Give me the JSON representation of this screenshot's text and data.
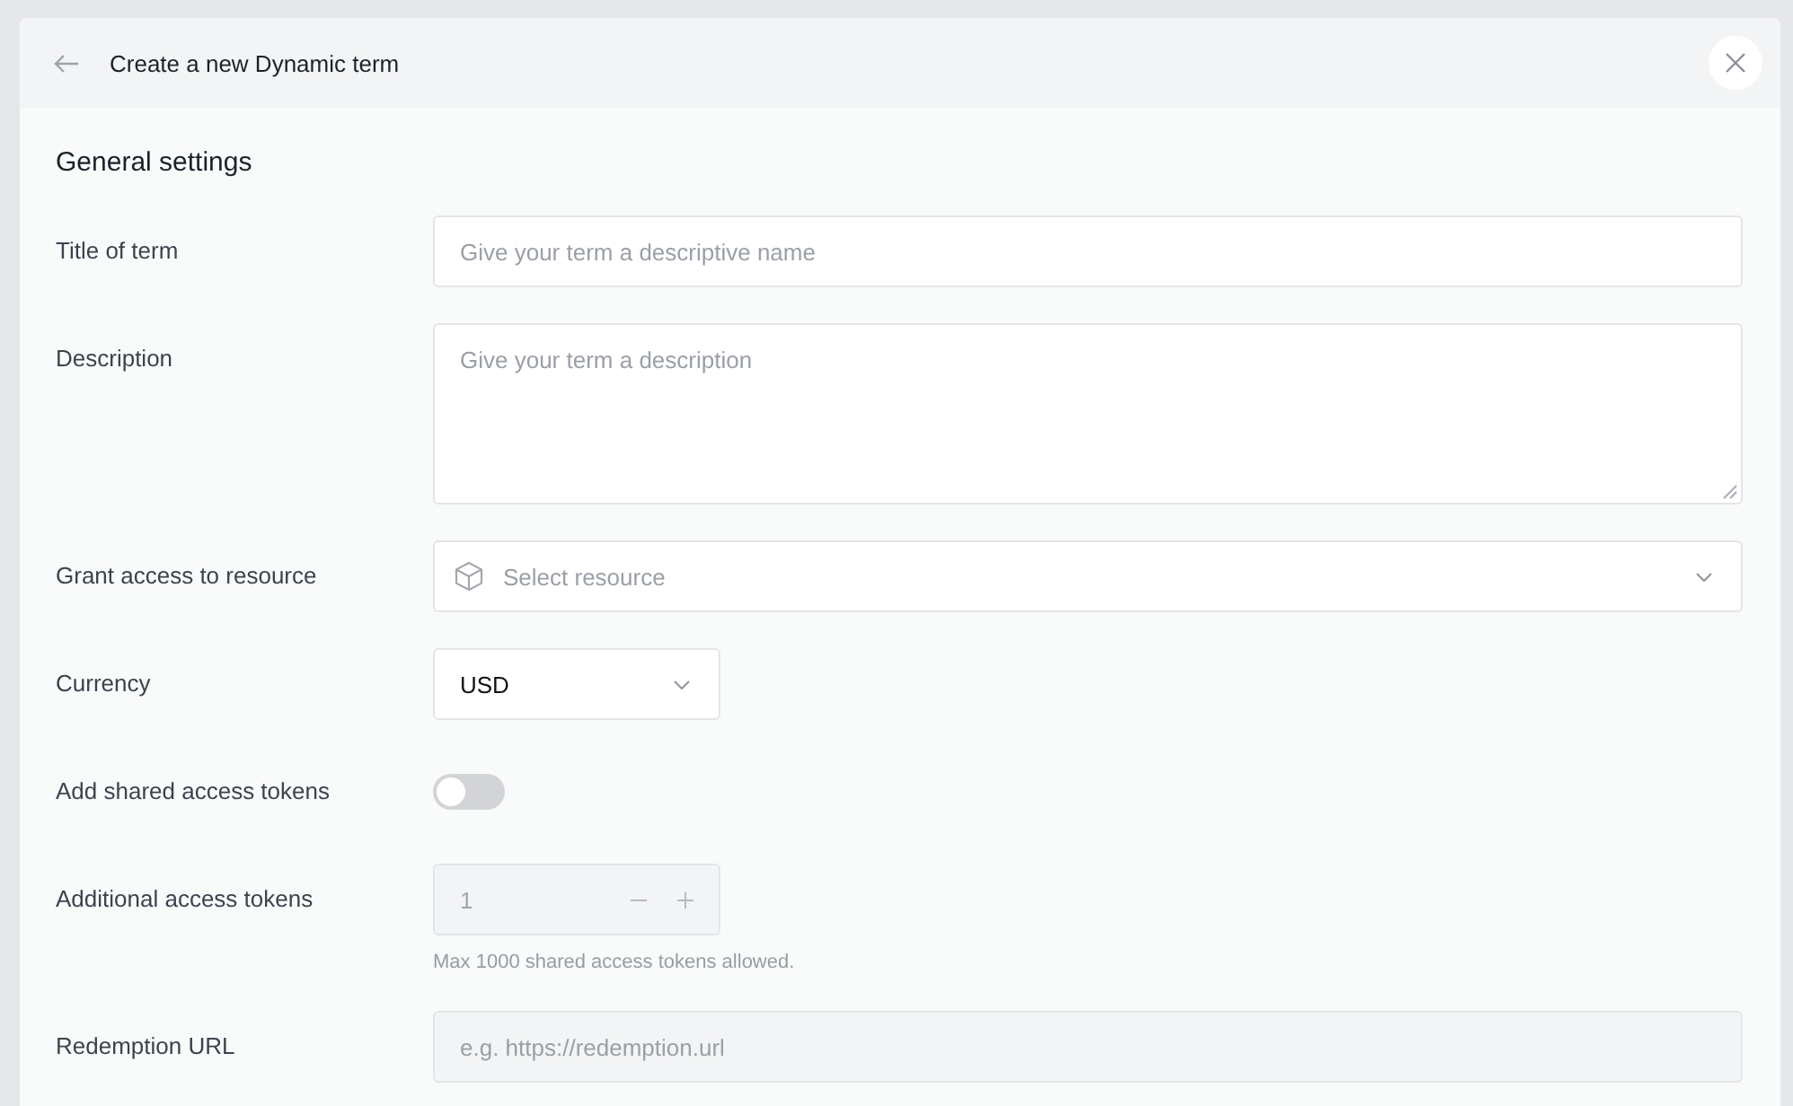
{
  "header": {
    "title": "Create a new Dynamic term"
  },
  "section": {
    "title": "General settings"
  },
  "fields": [
    {
      "kind": "text",
      "label": "Title of term",
      "placeholder": "Give your term a descriptive name",
      "disabled": false
    },
    {
      "kind": "textarea",
      "label": "Description",
      "placeholder": "Give your term a description",
      "disabled": false
    },
    {
      "kind": "resource-select",
      "label": "Grant access to resource",
      "placeholder": "Select resource",
      "disabled": false
    },
    {
      "kind": "select",
      "label": "Currency",
      "value": "USD",
      "disabled": false
    },
    {
      "kind": "toggle",
      "label": "Add shared access tokens",
      "on": false,
      "disabled": false
    },
    {
      "kind": "stepper",
      "label": "Additional access tokens",
      "value": "1",
      "hint": "Max 1000 shared access tokens allowed.",
      "disabled": true
    },
    {
      "kind": "text",
      "label": "Redemption URL",
      "placeholder": "e.g. https://redemption.url",
      "disabled": true
    }
  ]
}
